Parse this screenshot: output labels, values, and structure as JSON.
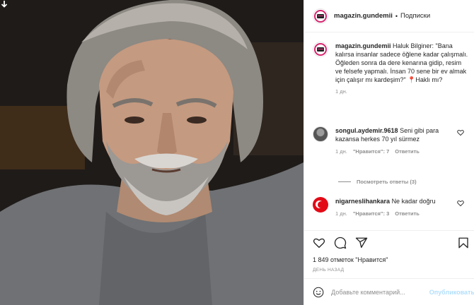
{
  "header": {
    "username": "magazin.gundemii",
    "separator": "•",
    "follow_label": "Подписки"
  },
  "caption": {
    "username": "magazin.gundemii",
    "text": "Haluk Bilginer: \"Bana kalırsa insanlar sadece öğlene kadar çalışmalı. Öğleden sonra da dere kenarına gidip, resim ve felsefe yapmalı. İnsan 70 sene bir ev almak için çalışır mı kardeşim?\" 📍Haklı mı?",
    "time": "1 дн."
  },
  "comments": [
    {
      "username": "songul.aydemir.9618",
      "text": "Seni gibi para kazansa herkes 70 yıl sürmez",
      "time": "1 дн.",
      "likes": "\"Нравится\": 7",
      "reply": "Ответить"
    },
    {
      "username": "nigarneslihankara",
      "text": "Ne kadar doğru",
      "time": "1 дн.",
      "likes": "\"Нравится\": 3",
      "reply": "Ответить"
    }
  ],
  "view_replies": "Посмотреть ответы (3)",
  "likes_text": "1 849 отметок \"Нравится\"",
  "posted_ago": "день назад",
  "add_comment": {
    "placeholder": "Добавьте комментарий...",
    "post_label": "Опубликовать"
  },
  "icons": {
    "like": "heart-icon",
    "comment": "comment-icon",
    "share": "share-icon",
    "save": "bookmark-icon",
    "emoji": "smile-icon",
    "arrow": "download-arrow-icon"
  }
}
